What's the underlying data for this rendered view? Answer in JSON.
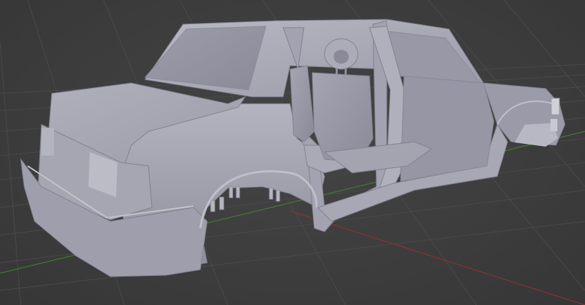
{
  "viewport": {
    "background_color": "#3d3d3d",
    "grid_color": "#4a4a4a",
    "x_axis_color": "#8a3232",
    "y_axis_color": "#3f7a2e",
    "mesh_color": "#a8a8b4",
    "mesh_shadow_color": "#6f6f7c",
    "mesh_highlight_color": "#c8c8d2",
    "object": "car-body-mesh",
    "shading": "solid"
  }
}
